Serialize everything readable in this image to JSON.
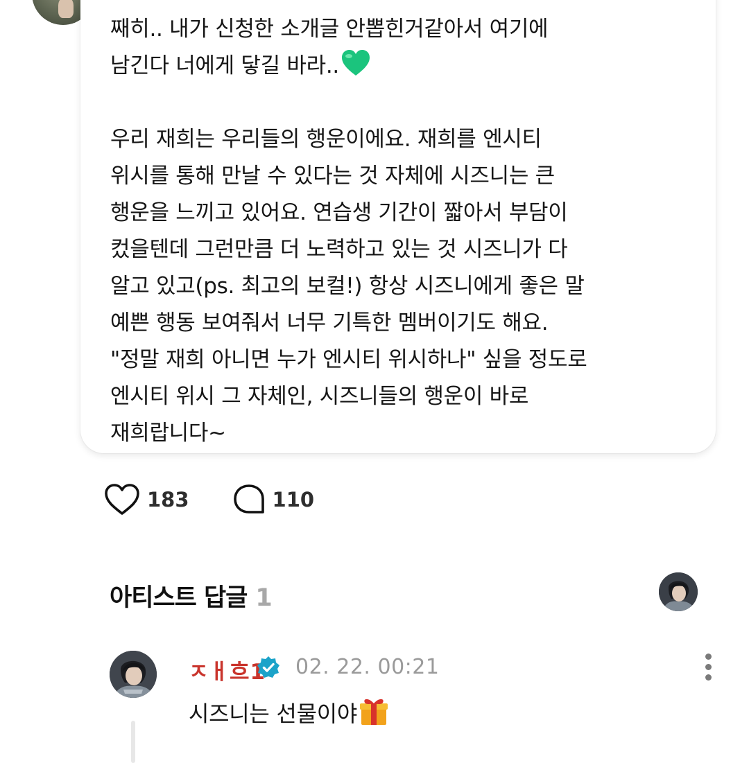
{
  "post": {
    "text": "째히.. 내가 신청한 소개글 안뽑힌거같아서 여기에\n남긴다 너에게 닿길 바라..\n\n우리 재희는 우리들의 행운이에요. 재희를 엔시티\n위시를 통해 만날 수 있다는 것 자체에 시즈니는 큰\n행운을 느끼고 있어요. 연습생 기간이 짧아서 부담이\n컸을텐데 그런만큼 더 노력하고 있는 것 시즈니가 다\n알고 있고(ps.  최고의 보컬!) 항상 시즈니에게 좋은 말\n예쁜 행동 보여줘서 너무 기특한 멤버이기도 해요.\n\"정말 재희 아니면 누가 엔시티 위시하나\" 싶을 정도로\n엔시티 위시 그 자체인, 시즈니들의 행운이 바로\n재희랍니다~",
    "emoji_after_line2": "green-heart-emoji",
    "like_count": "183",
    "comment_count": "110"
  },
  "artist_replies": {
    "title": "아티스트 답글",
    "count": "1",
    "items": [
      {
        "name": "ㅈㅐ흐1",
        "time": "02. 22. 00:21",
        "text": "시즈니는 선물이야",
        "emoji": "gift-emoji"
      }
    ]
  },
  "colors": {
    "artist_name": "#c9342c",
    "verified_badge": "#1ca3c9",
    "muted": "#9a9a9a",
    "heart_emoji": "#1bc47d"
  },
  "icons": [
    "heart-icon",
    "comment-icon",
    "verified-badge-icon",
    "more-options-icon"
  ]
}
